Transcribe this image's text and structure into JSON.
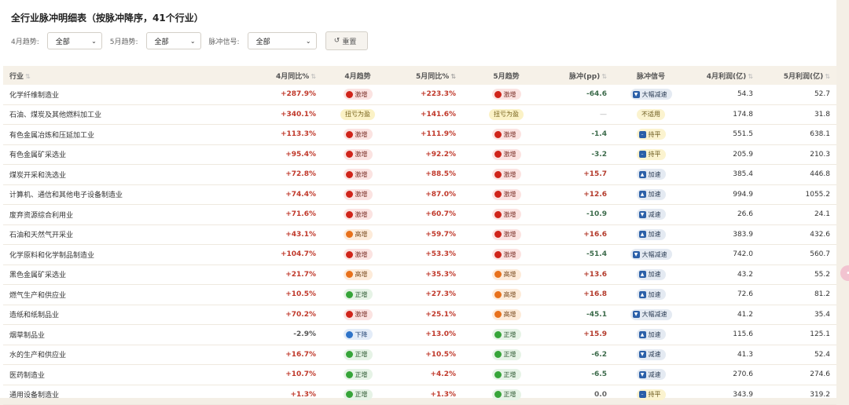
{
  "title": "全行业脉冲明细表（按脉冲降序，41个行业）",
  "filters": {
    "april_label": "4月趋势:",
    "april_value": "全部",
    "may_label": "5月趋势:",
    "may_value": "全部",
    "signal_label": "脉冲信号:",
    "signal_value": "全部",
    "reset_label": "重置",
    "reset_icon": "refresh-icon"
  },
  "table": {
    "headers": {
      "name": "行业",
      "apr_yoy": "4月同比%",
      "apr_trend": "4月趋势",
      "may_yoy": "5月同比%",
      "may_trend": "5月趋势",
      "pulse": "脉冲(pp)",
      "signal": "脉冲信号",
      "apr_profit": "4月利润(亿)",
      "may_profit": "5月利润(亿)"
    },
    "sort_glyph": "⇅",
    "signal_glyphs": {
      "up": "▲",
      "down": "▼",
      "flat": "–"
    },
    "rows": [
      {
        "name": "化学纤维制造业",
        "apr": "+287.9%",
        "apr_t": "激增",
        "may": "+223.3%",
        "may_t": "激增",
        "pulse": "-64.6",
        "sig": "大幅减速",
        "sig_type": "down",
        "apr_p": "54.3",
        "may_p": "52.7"
      },
      {
        "name": "石油、煤炭及其他燃料加工业",
        "apr": "+340.1%",
        "apr_t": "扭亏为盈",
        "may": "+141.6%",
        "may_t": "扭亏为盈",
        "pulse": "—",
        "sig": "不适用",
        "sig_type": "na",
        "apr_p": "174.8",
        "may_p": "31.8"
      },
      {
        "name": "有色金属冶炼和压延加工业",
        "apr": "+113.3%",
        "apr_t": "激增",
        "may": "+111.9%",
        "may_t": "激增",
        "pulse": "-1.4",
        "sig": "持平",
        "sig_type": "flat",
        "apr_p": "551.5",
        "may_p": "638.1"
      },
      {
        "name": "有色金属矿采选业",
        "apr": "+95.4%",
        "apr_t": "激增",
        "may": "+92.2%",
        "may_t": "激增",
        "pulse": "-3.2",
        "sig": "持平",
        "sig_type": "flat",
        "apr_p": "205.9",
        "may_p": "210.3"
      },
      {
        "name": "煤炭开采和洗选业",
        "apr": "+72.8%",
        "apr_t": "激增",
        "may": "+88.5%",
        "may_t": "激增",
        "pulse": "+15.7",
        "sig": "加速",
        "sig_type": "up",
        "apr_p": "385.4",
        "may_p": "446.8"
      },
      {
        "name": "计算机、通信和其他电子设备制造业",
        "apr": "+74.4%",
        "apr_t": "激增",
        "may": "+87.0%",
        "may_t": "激增",
        "pulse": "+12.6",
        "sig": "加速",
        "sig_type": "up",
        "apr_p": "994.9",
        "may_p": "1055.2"
      },
      {
        "name": "废弃资源综合利用业",
        "apr": "+71.6%",
        "apr_t": "激增",
        "may": "+60.7%",
        "may_t": "激增",
        "pulse": "-10.9",
        "sig": "减速",
        "sig_type": "down",
        "apr_p": "26.6",
        "may_p": "24.1"
      },
      {
        "name": "石油和天然气开采业",
        "apr": "+43.1%",
        "apr_t": "高增",
        "may": "+59.7%",
        "may_t": "激增",
        "pulse": "+16.6",
        "sig": "加速",
        "sig_type": "up",
        "apr_p": "383.9",
        "may_p": "432.6"
      },
      {
        "name": "化学原料和化学制品制造业",
        "apr": "+104.7%",
        "apr_t": "激增",
        "may": "+53.3%",
        "may_t": "激增",
        "pulse": "-51.4",
        "sig": "大幅减速",
        "sig_type": "down",
        "apr_p": "742.0",
        "may_p": "560.7"
      },
      {
        "name": "黑色金属矿采选业",
        "apr": "+21.7%",
        "apr_t": "高增",
        "may": "+35.3%",
        "may_t": "高增",
        "pulse": "+13.6",
        "sig": "加速",
        "sig_type": "up",
        "apr_p": "43.2",
        "may_p": "55.2"
      },
      {
        "name": "燃气生产和供应业",
        "apr": "+10.5%",
        "apr_t": "正增",
        "may": "+27.3%",
        "may_t": "高增",
        "pulse": "+16.8",
        "sig": "加速",
        "sig_type": "up",
        "apr_p": "72.6",
        "may_p": "81.2"
      },
      {
        "name": "造纸和纸制品业",
        "apr": "+70.2%",
        "apr_t": "激增",
        "may": "+25.1%",
        "may_t": "高增",
        "pulse": "-45.1",
        "sig": "大幅减速",
        "sig_type": "down",
        "apr_p": "41.2",
        "may_p": "35.4"
      },
      {
        "name": "烟草制品业",
        "apr": "-2.9%",
        "apr_t": "下降",
        "may": "+13.0%",
        "may_t": "正增",
        "pulse": "+15.9",
        "sig": "加速",
        "sig_type": "up",
        "apr_p": "115.6",
        "may_p": "125.1"
      },
      {
        "name": "水的生产和供应业",
        "apr": "+16.7%",
        "apr_t": "正增",
        "may": "+10.5%",
        "may_t": "正增",
        "pulse": "-6.2",
        "sig": "减速",
        "sig_type": "down",
        "apr_p": "41.3",
        "may_p": "52.4"
      },
      {
        "name": "医药制造业",
        "apr": "+10.7%",
        "apr_t": "正增",
        "may": "+4.2%",
        "may_t": "正增",
        "pulse": "-6.5",
        "sig": "减速",
        "sig_type": "down",
        "apr_p": "270.6",
        "may_p": "274.6"
      },
      {
        "name": "通用设备制造业",
        "apr": "+1.3%",
        "apr_t": "正增",
        "may": "+1.3%",
        "may_t": "正增",
        "pulse": "0.0",
        "sig": "持平",
        "sig_type": "flat",
        "apr_p": "343.9",
        "may_p": "319.2"
      }
    ]
  },
  "colors": {
    "jizeng": "#d0241a",
    "gaozeng": "#e8711b",
    "zhengzeng": "#36a539",
    "xiajiang": "#2f74c9",
    "signal_square": "#2a5fa8"
  }
}
